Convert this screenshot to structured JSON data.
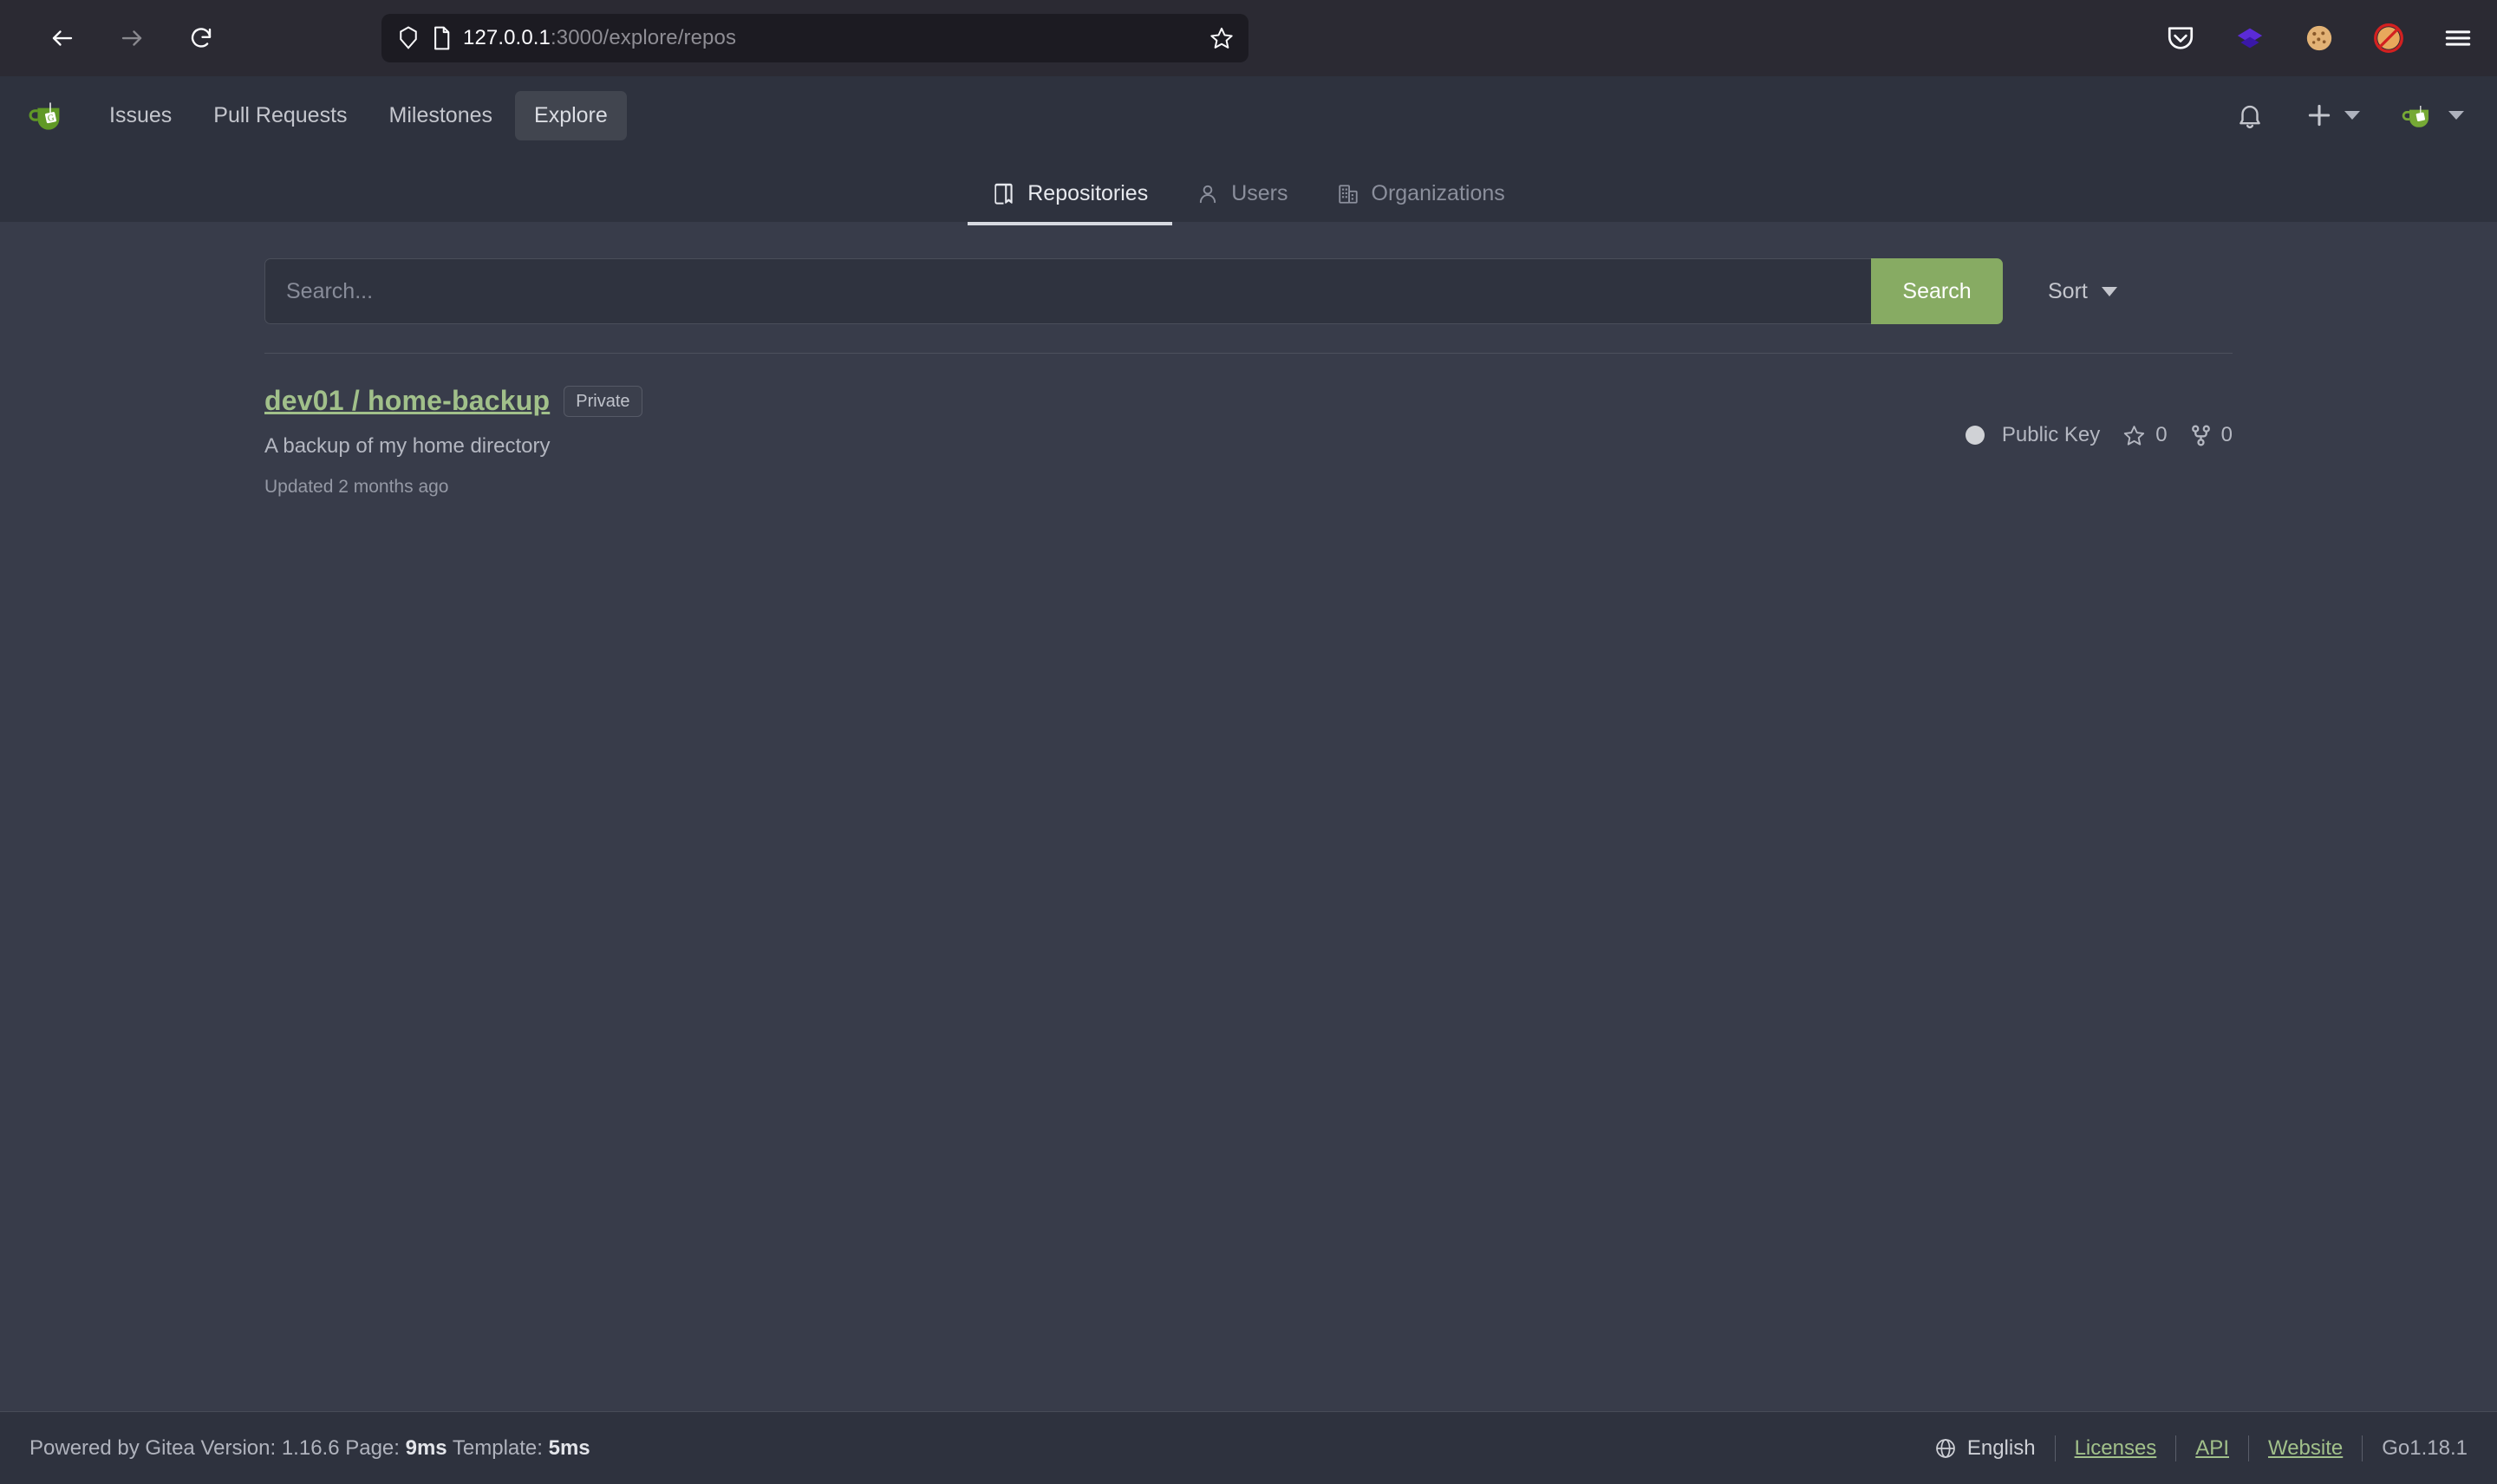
{
  "browser": {
    "back_icon": "arrow-left-icon",
    "forward_icon": "arrow-right-icon",
    "reload_icon": "reload-icon",
    "shield_icon": "shield-icon",
    "page_icon": "page-document-icon",
    "url_host": "127.0.0.1",
    "url_path": ":3000/explore/repos",
    "bookmark_icon": "star-outline-icon",
    "extensions": [
      {
        "name": "pocket-icon",
        "glyph": ""
      },
      {
        "name": "layers-extension-icon",
        "glyph": ""
      },
      {
        "name": "cookie-extension-icon",
        "glyph": "🍪"
      },
      {
        "name": "blocked-fox-extension-icon",
        "glyph": ""
      },
      {
        "name": "hamburger-menu-icon",
        "glyph": ""
      }
    ]
  },
  "gitea_nav": {
    "logo": "gitea-teacup-logo",
    "links": [
      {
        "label": "Issues",
        "active": false
      },
      {
        "label": "Pull Requests",
        "active": false
      },
      {
        "label": "Milestones",
        "active": false
      },
      {
        "label": "Explore",
        "active": true
      }
    ],
    "notifications_icon": "bell-icon",
    "create_icon": "plus-icon",
    "avatar_icon": "gitea-avatar"
  },
  "tabs": [
    {
      "label": "Repositories",
      "icon": "repo-icon",
      "active": true
    },
    {
      "label": "Users",
      "icon": "person-icon",
      "active": false
    },
    {
      "label": "Organizations",
      "icon": "organization-building-icon",
      "active": false
    }
  ],
  "search": {
    "placeholder": "Search...",
    "value": "",
    "button_label": "Search",
    "sort_label": "Sort"
  },
  "repositories": [
    {
      "owner": "dev01",
      "separator": "/",
      "name": "home-backup",
      "full_name": "dev01 / home-backup",
      "visibility_badge": "Private",
      "description": "A backup of my home directory",
      "updated": "Updated 2 months ago",
      "language": "Public Key",
      "stars": "0",
      "forks": "0"
    }
  ],
  "footer": {
    "powered_prefix": "Powered by Gitea Version: 1.16.6 Page: ",
    "page_time": "9ms",
    "template_prefix": " Template: ",
    "template_time": "5ms",
    "language_icon": "globe-icon",
    "language": "English",
    "links": [
      {
        "label": "Licenses"
      },
      {
        "label": "API"
      },
      {
        "label": "Website"
      }
    ],
    "go_version": "Go1.18.1"
  },
  "colors": {
    "chrome_bg": "#2b2a33",
    "urlbar_bg": "#1c1b22",
    "nav_bg": "#2e323e",
    "body_bg": "#383c4a",
    "accent_green": "#87ab63",
    "link_green": "#a1c08a",
    "text_primary": "#dbdde3",
    "text_muted": "#8b8f9c"
  }
}
